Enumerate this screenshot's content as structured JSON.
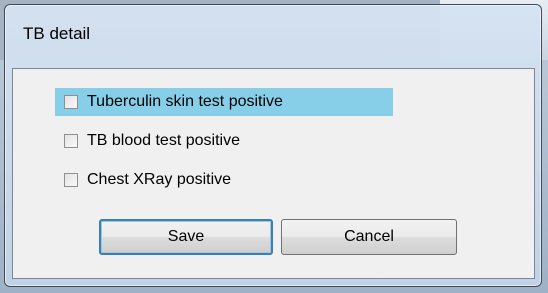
{
  "dialog": {
    "title": "TB detail",
    "options": [
      {
        "label": "Tuberculin skin test positive",
        "checked": false,
        "selected": true
      },
      {
        "label": "TB blood test positive",
        "checked": false,
        "selected": false
      },
      {
        "label": "Chest XRay positive",
        "checked": false,
        "selected": false
      }
    ],
    "buttons": {
      "save_label": "Save",
      "cancel_label": "Cancel"
    }
  },
  "colors": {
    "selection_highlight": "#87cfe8",
    "default_button_border": "#3c7fb1",
    "client_background": "#f0f0f0"
  }
}
